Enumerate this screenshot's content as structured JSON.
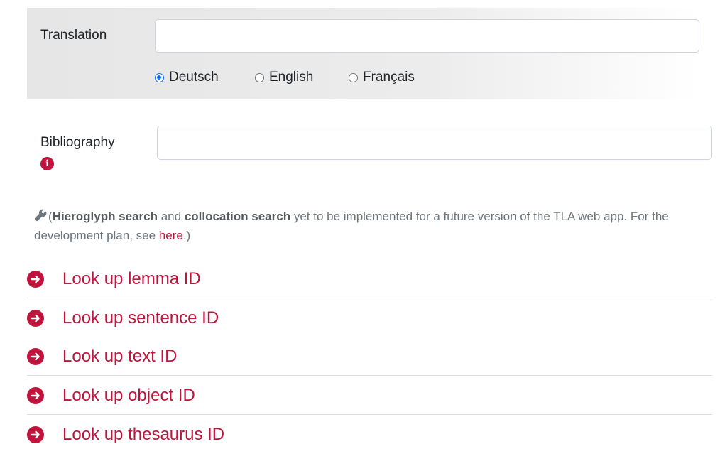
{
  "translation": {
    "label": "Translation",
    "input_value": "",
    "languages": [
      {
        "label": "Deutsch",
        "checked": true
      },
      {
        "label": "English",
        "checked": false
      },
      {
        "label": "Français",
        "checked": false
      }
    ]
  },
  "bibliography": {
    "label": "Bibliography",
    "input_value": "",
    "info_glyph": "i"
  },
  "note": {
    "open_paren": "(",
    "hieroglyph_search": "Hieroglyph search",
    "and": " and ",
    "collocation_search": "collocation search",
    "rest": " yet to be implemented for a future version of the TLA web app. For the development plan, see ",
    "link_text": "here",
    "close": ".)"
  },
  "lookups": [
    {
      "label": "Look up lemma ID"
    },
    {
      "label": "Look up sentence ID"
    },
    {
      "label": "Look up text ID"
    },
    {
      "label": "Look up object ID"
    },
    {
      "label": "Look up thesaurus ID"
    }
  ],
  "colors": {
    "accent": "#c0143c",
    "radio_checked": "#0d6efd",
    "panel_bg": "#e6e6e6",
    "note_text": "#6c757d"
  },
  "icons": {
    "wrench": "wrench-icon",
    "info": "info-icon",
    "arrow": "arrow-circle-right-icon"
  }
}
